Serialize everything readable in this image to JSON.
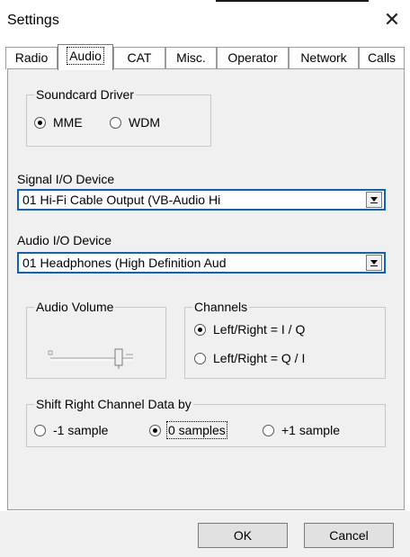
{
  "window": {
    "title": "Settings"
  },
  "tabs": [
    "Radio",
    "Audio",
    "CAT",
    "Misc.",
    "Operator",
    "Network",
    "Calls"
  ],
  "soundcard": {
    "legend": "Soundcard Driver",
    "options": [
      "MME",
      "WDM"
    ],
    "selected": "MME"
  },
  "signal_io": {
    "label": "Signal I/O Device",
    "value": "01  Hi-Fi Cable Output (VB-Audio Hi"
  },
  "audio_io": {
    "label": "Audio I/O Device",
    "value": "01  Headphones (High Definition Aud"
  },
  "audio_volume": {
    "legend": "Audio Volume"
  },
  "channels": {
    "legend": "Channels",
    "options": [
      "Left/Right = I / Q",
      "Left/Right = Q / I"
    ],
    "selected": "Left/Right = I / Q"
  },
  "shift": {
    "legend": "Shift Right Channel Data by",
    "options": [
      "-1 sample",
      "0 samples",
      "+1 sample"
    ],
    "selected": "0 samples"
  },
  "buttons": {
    "ok": "OK",
    "cancel": "Cancel"
  },
  "colors": {
    "focus_border": "#0b63ba",
    "panel_bg": "#f0f0f0"
  }
}
